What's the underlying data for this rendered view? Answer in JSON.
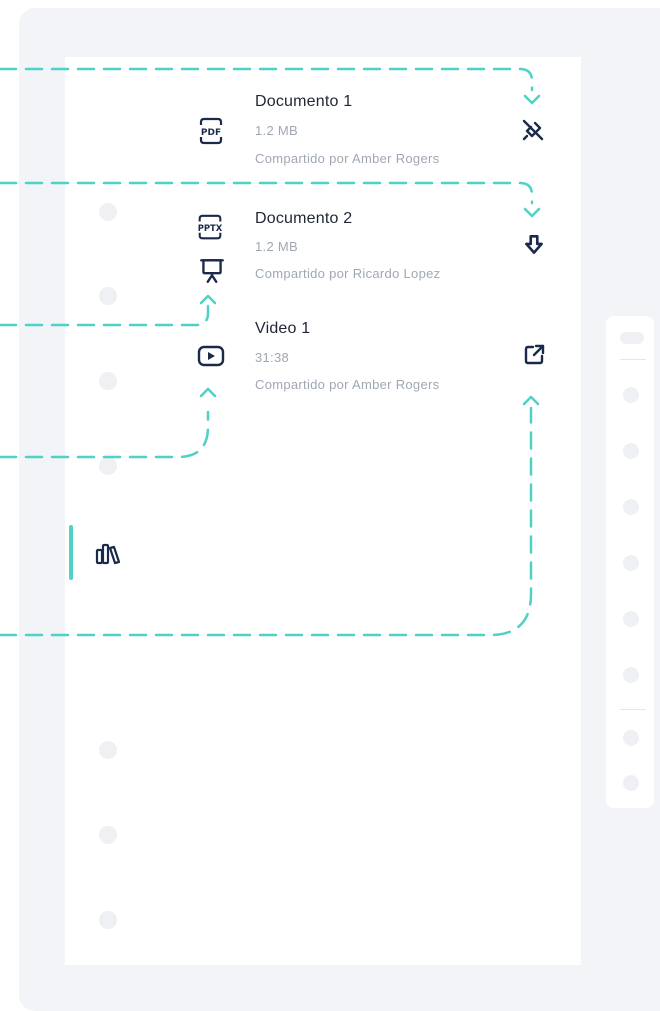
{
  "colors": {
    "accent": "#4fd1c5",
    "icon_dark": "#1b2a4a",
    "text_primary": "#1f2633",
    "text_muted": "#a0a7b4",
    "panel_bg": "#f3f4f7"
  },
  "files": [
    {
      "title": "Documento 1",
      "size": "1.2 MB",
      "shared_by": "Compartido por Amber Rogers",
      "type_icon": "pdf-file-icon",
      "type_icon_text": "PDF",
      "action_icon": "offline-unavailable-icon"
    },
    {
      "title": "Documento 2",
      "size": "1.2 MB",
      "shared_by": "Compartido por Ricardo Lopez",
      "type_icon": "pptx-file-icon",
      "type_icon_text": "PPTX",
      "action_icon": "download-icon"
    },
    {
      "title": "Video 1",
      "size": "31:38",
      "shared_by": "Compartido por Amber Rogers",
      "type_icon": "video-play-icon",
      "action_icon": "open-external-icon"
    }
  ],
  "sidebar": {
    "active_icon": "library-icon"
  }
}
